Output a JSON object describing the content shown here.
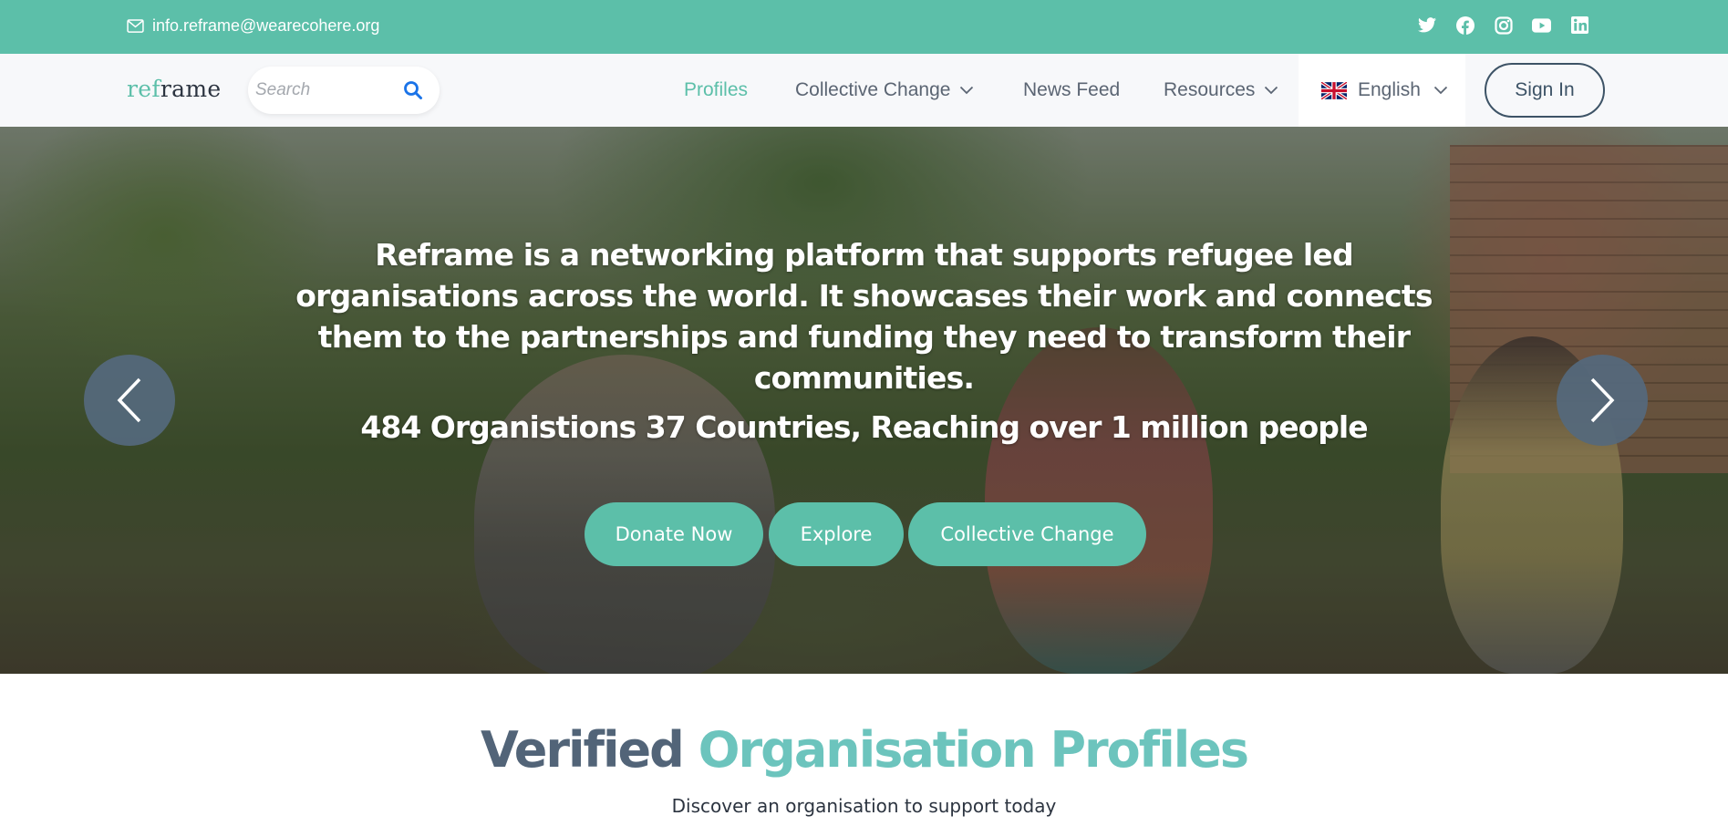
{
  "topbar": {
    "email": "info.reframe@wearecohere.org",
    "email_icon": "envelope-icon",
    "socials": [
      "twitter-icon",
      "facebook-icon",
      "instagram-icon",
      "youtube-icon",
      "linkedin-icon"
    ]
  },
  "navbar": {
    "logo_part1": "ref",
    "logo_part2": "rame",
    "search_placeholder": "Search",
    "items": [
      {
        "label": "Profiles",
        "active": true
      },
      {
        "label": "Collective Change",
        "dropdown": true
      },
      {
        "label": "News Feed"
      },
      {
        "label": "Resources",
        "dropdown": true
      }
    ],
    "language": "English",
    "sign_in": "Sign In"
  },
  "hero": {
    "description": "Reframe is a networking platform that supports refugee led organisations across the world. It showcases their work and connects them to the partnerships and funding they need to transform their communities.",
    "stats": "484 Organistions 37 Countries, Reaching over 1 million people",
    "buttons": {
      "donate": "Donate Now",
      "explore": "Explore",
      "collective": "Collective Change"
    }
  },
  "section": {
    "title_part1": "Verified",
    "title_part2": "Organisation Profiles",
    "subtitle": "Discover an organisation to support today"
  },
  "colors": {
    "accent": "#5cbfa9",
    "title_dark": "#526478",
    "title_teal": "#6cc4bd",
    "arrow_bg": "#55697d"
  }
}
